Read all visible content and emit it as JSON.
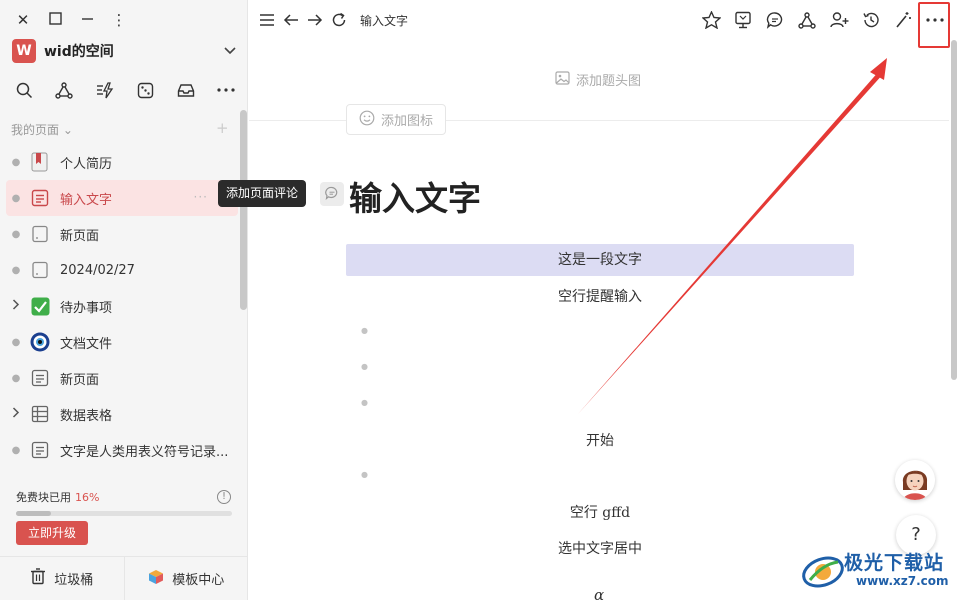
{
  "sidebar": {
    "space_initial": "W",
    "space_name": "wid的空间",
    "section_label": "我的页面 ⌄",
    "pages": [
      {
        "label": "个人简历",
        "icon": "bookmark-book-icon",
        "expandable": false
      },
      {
        "label": "输入文字",
        "icon": "doc-page-icon",
        "expandable": false,
        "active": true
      },
      {
        "label": "新页面",
        "icon": "blank-page-icon",
        "expandable": false
      },
      {
        "label": "2024/02/27",
        "icon": "blank-page-icon",
        "expandable": false
      },
      {
        "label": "待办事项",
        "icon": "green-check-icon",
        "expandable": true
      },
      {
        "label": "文档文件",
        "icon": "eye-amulet-icon",
        "expandable": false
      },
      {
        "label": "新页面",
        "icon": "doc-page-icon",
        "expandable": false
      },
      {
        "label": "数据表格",
        "icon": "table-icon",
        "expandable": true
      },
      {
        "label": "文字是人类用表义符号记录...",
        "icon": "doc-page-icon",
        "expandable": false
      }
    ],
    "usage_label": "免费块已用",
    "usage_percent": "16%",
    "usage_fraction": 0.16,
    "upgrade_label": "立即升级",
    "trash_label": "垃圾桶",
    "templates_label": "模板中心"
  },
  "tooltip": "添加页面评论",
  "main": {
    "tab_title": "输入文字",
    "add_cover_label": "添加题头图",
    "add_icon_label": "添加图标",
    "doc_title": "输入文字",
    "highlight_text": "这是一段文字",
    "line_1": "空行提醒输入",
    "line_start": "开始",
    "line_gffd": "空行 gffd",
    "line_center": "选中文字居中",
    "alpha_symbol": "α",
    "help_label": "?"
  },
  "watermark": {
    "text": "极光下载站",
    "url": "www.xz7.com"
  },
  "colors": {
    "accent": "#d9534f",
    "highlight_bg": "#dcdcf3",
    "annotation_red": "#e53935"
  }
}
